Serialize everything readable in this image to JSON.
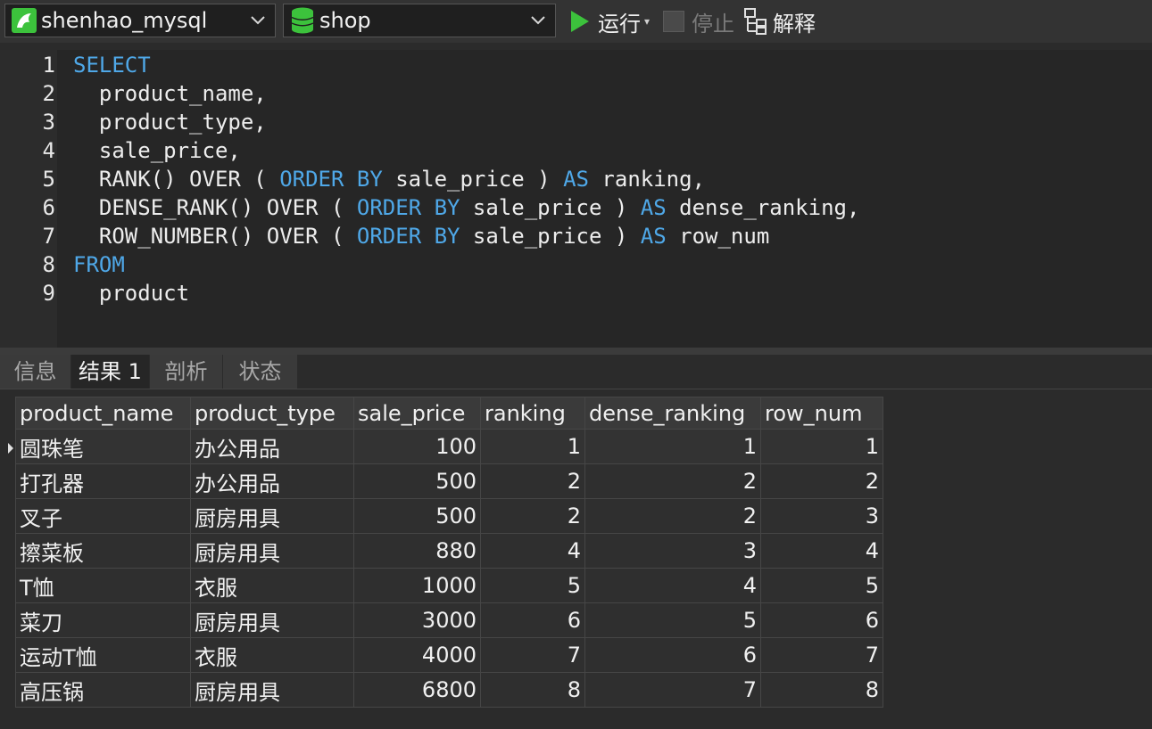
{
  "toolbar": {
    "connection": "shenhao_mysql",
    "database": "shop",
    "run_label": "运行",
    "stop_label": "停止",
    "explain_label": "解释"
  },
  "editor": {
    "lines": [
      {
        "n": "1",
        "parts": [
          {
            "t": "SELECT",
            "k": true
          }
        ]
      },
      {
        "n": "2",
        "parts": [
          {
            "t": "  product_name,",
            "k": false
          }
        ]
      },
      {
        "n": "3",
        "parts": [
          {
            "t": "  product_type,",
            "k": false
          }
        ]
      },
      {
        "n": "4",
        "parts": [
          {
            "t": "  sale_price,",
            "k": false
          }
        ]
      },
      {
        "n": "5",
        "parts": [
          {
            "t": "  RANK() OVER ( ",
            "k": false
          },
          {
            "t": "ORDER BY",
            "k": true
          },
          {
            "t": " sale_price ) ",
            "k": false
          },
          {
            "t": "AS",
            "k": true
          },
          {
            "t": " ranking,",
            "k": false
          }
        ]
      },
      {
        "n": "6",
        "parts": [
          {
            "t": "  DENSE_RANK() OVER ( ",
            "k": false
          },
          {
            "t": "ORDER BY",
            "k": true
          },
          {
            "t": " sale_price ) ",
            "k": false
          },
          {
            "t": "AS",
            "k": true
          },
          {
            "t": " dense_ranking,",
            "k": false
          }
        ]
      },
      {
        "n": "7",
        "parts": [
          {
            "t": "  ROW_NUMBER() OVER ( ",
            "k": false
          },
          {
            "t": "ORDER BY",
            "k": true
          },
          {
            "t": " sale_price ) ",
            "k": false
          },
          {
            "t": "AS",
            "k": true
          },
          {
            "t": " row_num",
            "k": false
          }
        ]
      },
      {
        "n": "8",
        "parts": [
          {
            "t": "FROM",
            "k": true
          }
        ]
      },
      {
        "n": "9",
        "parts": [
          {
            "t": "  product",
            "k": false
          }
        ]
      }
    ]
  },
  "tabs": [
    {
      "label": "信息",
      "active": false
    },
    {
      "label": "结果 1",
      "active": true
    },
    {
      "label": "剖析",
      "active": false
    },
    {
      "label": "状态",
      "active": false
    }
  ],
  "grid": {
    "columns": [
      "product_name",
      "product_type",
      "sale_price",
      "ranking",
      "dense_ranking",
      "row_num"
    ],
    "rows": [
      [
        "圆珠笔",
        "办公用品",
        "100",
        "1",
        "1",
        "1"
      ],
      [
        "打孔器",
        "办公用品",
        "500",
        "2",
        "2",
        "2"
      ],
      [
        "叉子",
        "厨房用具",
        "500",
        "2",
        "2",
        "3"
      ],
      [
        "擦菜板",
        "厨房用具",
        "880",
        "4",
        "3",
        "4"
      ],
      [
        "T恤",
        "衣服",
        "1000",
        "5",
        "4",
        "5"
      ],
      [
        "菜刀",
        "厨房用具",
        "3000",
        "6",
        "5",
        "6"
      ],
      [
        "运动T恤",
        "衣服",
        "4000",
        "7",
        "6",
        "7"
      ],
      [
        "高压锅",
        "厨房用具",
        "6800",
        "8",
        "7",
        "8"
      ]
    ],
    "selected_row": 0
  },
  "colors": {
    "keyword": "#4fa8e8",
    "run_icon": "#3cc23c",
    "db_icon": "#3cc23c"
  }
}
